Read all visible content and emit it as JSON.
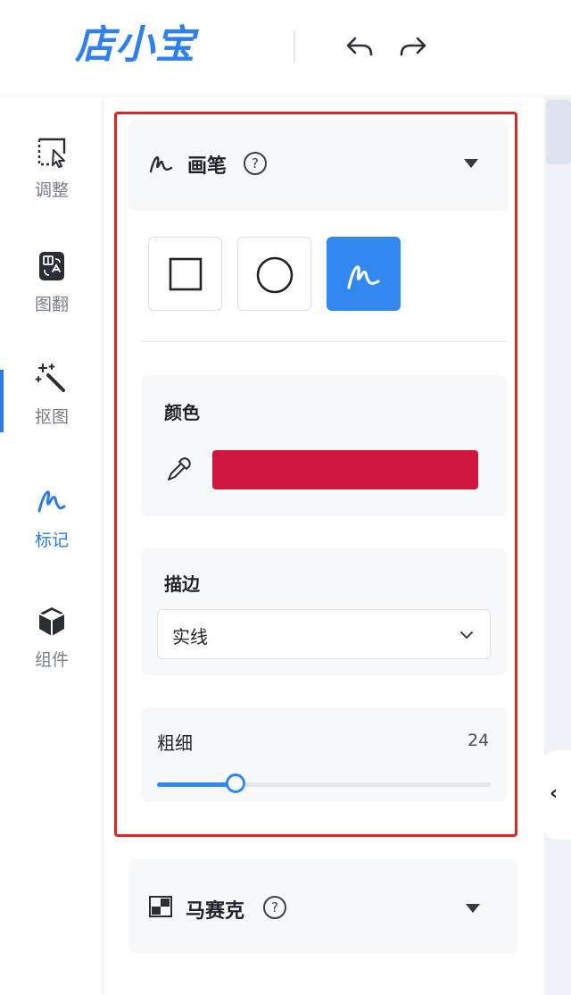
{
  "app": {
    "logo": "店小宝"
  },
  "toolbar": {
    "undo_icon": "undo-icon",
    "redo_icon": "redo-icon"
  },
  "sidebar": {
    "items": [
      {
        "label": "调整",
        "icon": "adjust-icon"
      },
      {
        "label": "图翻",
        "icon": "translate-icon"
      },
      {
        "label": "抠图",
        "icon": "magic-wand-icon"
      },
      {
        "label": "标记",
        "icon": "pen-icon",
        "active": true
      },
      {
        "label": "组件",
        "icon": "cube-icon"
      }
    ]
  },
  "brush_section": {
    "title": "画笔",
    "help": "?",
    "tools": [
      {
        "name": "rectangle",
        "icon": "square-icon"
      },
      {
        "name": "ellipse",
        "icon": "circle-icon"
      },
      {
        "name": "freehand",
        "icon": "pen-icon",
        "selected": true
      }
    ],
    "color": {
      "label": "颜色",
      "value": "#d0163f"
    },
    "stroke": {
      "label": "描边",
      "selected": "实线"
    },
    "thickness": {
      "label": "粗细",
      "value": "24",
      "fraction": 0.235
    }
  },
  "mosaic_section": {
    "title": "马赛克",
    "help": "?"
  },
  "colors": {
    "accent": "#3288ee",
    "highlight_border": "#e02424"
  }
}
